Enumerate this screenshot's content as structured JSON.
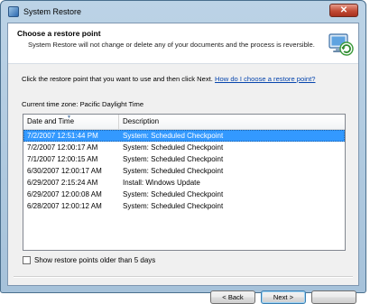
{
  "window": {
    "title": "System Restore",
    "close_glyph": "✕"
  },
  "header": {
    "title": "Choose a restore point",
    "subtitle": "System Restore will not change or delete any of your documents and the process is reversible.",
    "icon": "system-restore-icon"
  },
  "instruction": {
    "text": "Click the restore point that you want to use and then click Next.",
    "link": "How do I choose a restore point?"
  },
  "timezone": "Current time zone: Pacific Daylight Time",
  "table": {
    "columns": [
      "Date and Time",
      "Description"
    ],
    "rows": [
      {
        "date": "7/2/2007 12:51:44 PM",
        "description": "System: Scheduled Checkpoint",
        "selected": true
      },
      {
        "date": "7/2/2007 12:00:17 AM",
        "description": "System: Scheduled Checkpoint"
      },
      {
        "date": "7/1/2007 12:00:15 AM",
        "description": "System: Scheduled Checkpoint"
      },
      {
        "date": "6/30/2007 12:00:17 AM",
        "description": "System: Scheduled Checkpoint"
      },
      {
        "date": "6/29/2007 2:15:24 AM",
        "description": "Install: Windows Update"
      },
      {
        "date": "6/29/2007 12:00:08 AM",
        "description": "System: Scheduled Checkpoint"
      },
      {
        "date": "6/28/2007 12:00:12 AM",
        "description": "System: Scheduled Checkpoint"
      }
    ]
  },
  "show_older": {
    "label": "Show restore points older than 5 days",
    "checked": false
  },
  "buttons": {
    "back": "< Back",
    "next": "Next >",
    "cancel": ""
  },
  "colors": {
    "selection": "#3399ff",
    "link": "#0645ad",
    "frame": "#a6c2da"
  }
}
